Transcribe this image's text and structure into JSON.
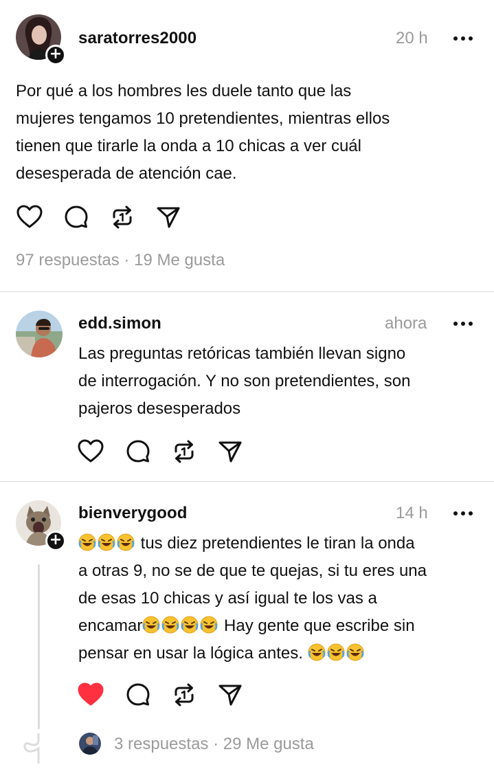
{
  "posts": [
    {
      "username": "saratorres2000",
      "time": "20 h",
      "text": "Por qué a los hombres les duele tanto que las\nmujeres tengamos 10 pretendientes, mientras ellos\ntienen que tirarle la onda a 10 chicas a ver cuál\ndesesperada de atención cae.",
      "stats": "97 respuestas · 19 Me gusta",
      "liked": false
    },
    {
      "username": "edd.simon",
      "time": "ahora",
      "text": "Las preguntas retóricas también llevan signo\nde interrogación. Y no son pretendientes, son\npajeros desesperados",
      "liked": false
    },
    {
      "username": "bienverygood",
      "time": "14 h",
      "text_line1": " tus diez pretendientes le tiran la onda",
      "text_line2": "a otras 9, no se de que te quejas, si tu eres una",
      "text_line3": "de esas 10 chicas y así igual te los vas a",
      "text_line4a": "encamar",
      "text_line4b": " Hay gente que escribe sin",
      "text_line5": "pensar en usar la lógica antes. ",
      "stats": "3 respuestas · 29 Me gusta",
      "liked": true
    }
  ],
  "icons": {
    "like": "heart-icon",
    "reply": "comment-icon",
    "repost": "repost-icon",
    "share": "send-icon",
    "more": "more-icon",
    "emoji": "rolling-laughing-emoji"
  },
  "colors": {
    "liked": "#ff3040",
    "muted": "#9a9a9a",
    "text": "#111111"
  }
}
